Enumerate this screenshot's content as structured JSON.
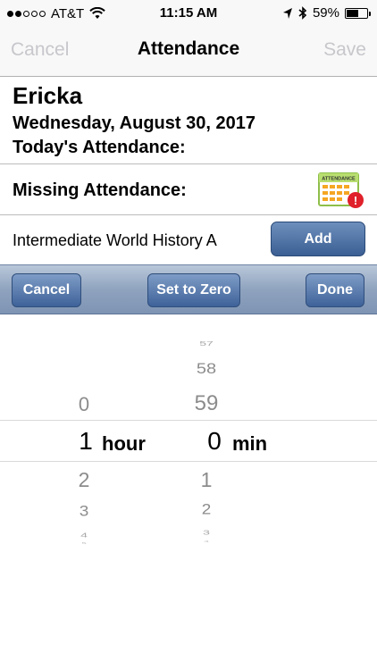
{
  "status": {
    "carrier": "AT&T",
    "time": "11:15 AM",
    "battery": "59%",
    "battery_level": 0.59
  },
  "nav": {
    "cancel": "Cancel",
    "title": "Attendance",
    "save": "Save"
  },
  "header": {
    "name": "Ericka",
    "date": "Wednesday, August 30, 2017",
    "today_label": "Today's Attendance:"
  },
  "missing": {
    "label": "Missing Attendance:",
    "icon_text": "ATTENDANCE",
    "icon_badge": "!"
  },
  "class_row": {
    "name": "Intermediate World History A",
    "add": "Add"
  },
  "toolbar": {
    "cancel": "Cancel",
    "zero": "Set to Zero",
    "done": "Done"
  },
  "picker": {
    "hours_above": [
      "0"
    ],
    "hours_selected": "1",
    "hours_unit": "hour",
    "hours_below": [
      "2",
      "3",
      "4",
      "5"
    ],
    "mins_above": [
      "57",
      "58",
      "59"
    ],
    "mins_selected": "0",
    "mins_unit": "min",
    "mins_below": [
      "1",
      "2",
      "3",
      "4"
    ]
  }
}
